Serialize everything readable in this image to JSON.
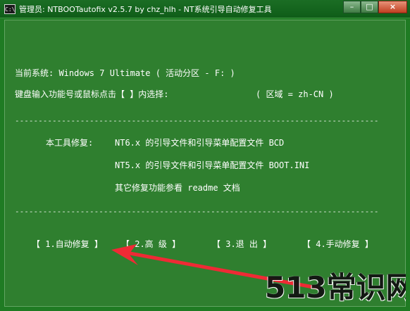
{
  "window": {
    "icon_text": "C:\\",
    "title": "管理员: NTBOOTautofix v2.5.7 by chz_hlh - NT系统引导自动修复工具",
    "controls": {
      "minimize": "–",
      "maximize": "□",
      "close": "×"
    }
  },
  "console": {
    "current_system": "当前系统: Windows 7 Ultimate  ( 活动分区 - F: )",
    "input_prompt": "键盘输入功能号或鼠标点击【 】内选择:",
    "region": "( 区域 = zh-CN )",
    "divider": "------------------------------------------------------------------------------",
    "repair_label": "本工具修复:",
    "repair_nt6": "NT6.x 的引导文件和引导菜单配置文件 BCD",
    "repair_nt5": "NT5.x 的引导文件和引导菜单配置文件 BOOT.INI",
    "other_repairs": "其它修复功能参看 readme 文档"
  },
  "menu": {
    "auto_repair": "【 1.自动修复 】",
    "advanced": "【 2.高  级 】",
    "exit": "【 3.退  出 】",
    "manual_repair": "【 4.手动修复 】"
  },
  "annotation": {
    "arrow_color": "#ef2a35"
  },
  "watermark": {
    "text": "513常识网"
  },
  "colors": {
    "console_background": "#2f7f2f",
    "titlebar_background": "#0f5d18",
    "text": "#ffffff"
  }
}
